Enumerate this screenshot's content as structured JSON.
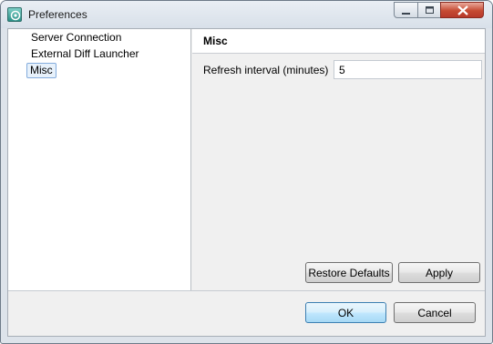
{
  "window": {
    "title": "Preferences",
    "app_icon": "preferences-app-icon",
    "controls": [
      "minimize-icon",
      "maximize-icon",
      "close-icon"
    ]
  },
  "sidebar": {
    "items": [
      {
        "label": "Server Connection",
        "selected": false
      },
      {
        "label": "External Diff Launcher",
        "selected": false
      },
      {
        "label": "Misc",
        "selected": true
      }
    ]
  },
  "page": {
    "title": "Misc",
    "fields": [
      {
        "label": "Refresh interval (minutes)",
        "value": "5"
      }
    ],
    "restore_defaults_label": "Restore Defaults",
    "apply_label": "Apply"
  },
  "dialog": {
    "ok_label": "OK",
    "cancel_label": "Cancel"
  },
  "colors": {
    "close_button": "#c64a32",
    "selection_border": "#84acdd",
    "default_button": "#bee6fd"
  }
}
